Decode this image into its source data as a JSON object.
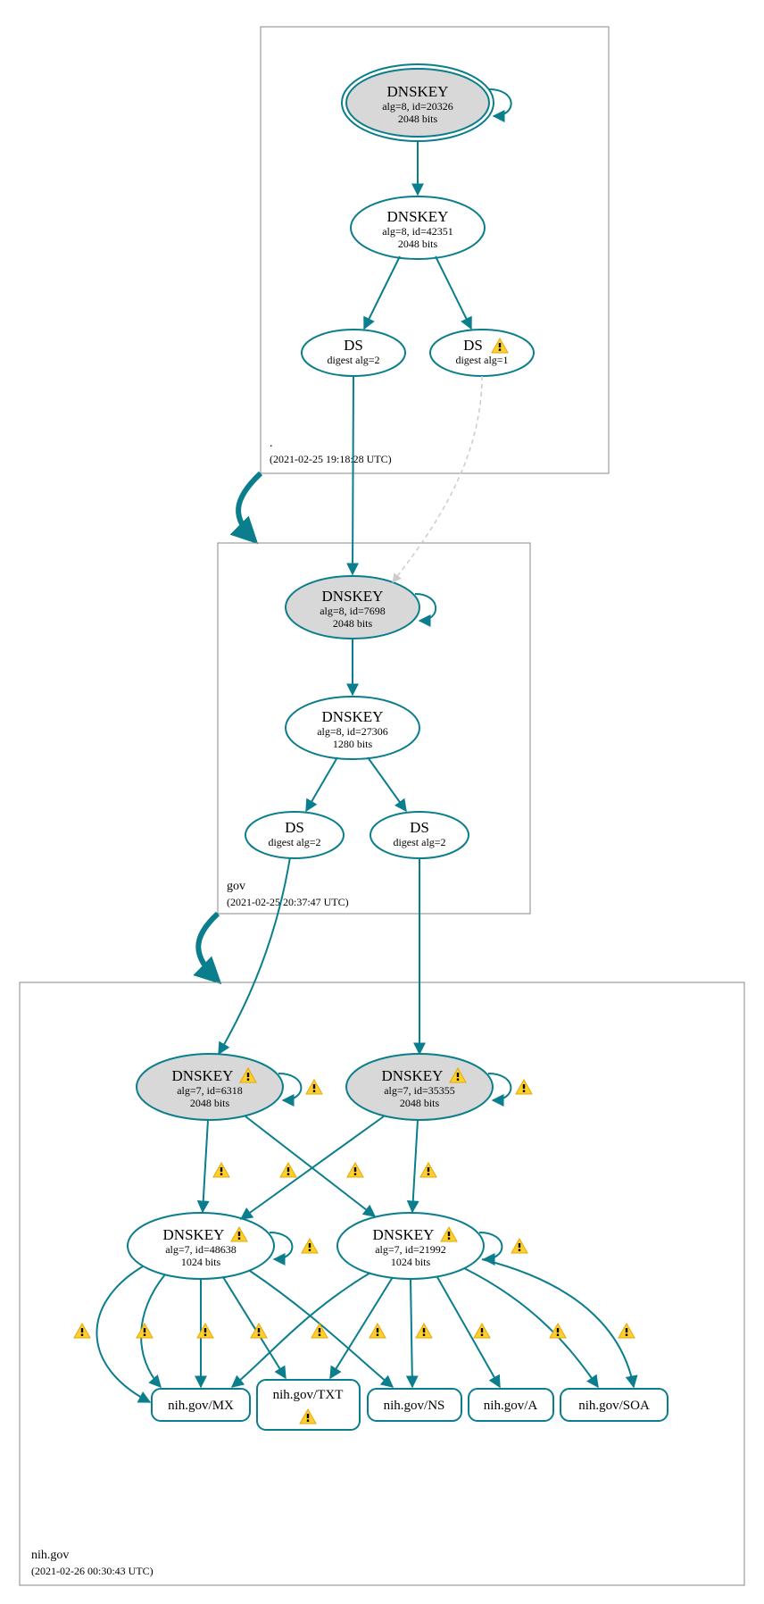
{
  "chart_data": {
    "type": "graph",
    "zones": [
      {
        "name": ".",
        "timestamp": "(2021-02-25 19:18:28 UTC)",
        "nodes": [
          {
            "id": "root_ksk",
            "type": "DNSKEY",
            "title": "DNSKEY",
            "line1": "alg=8, id=20326",
            "line2": "2048 bits",
            "fill": "gray",
            "double_border": true,
            "warn": false
          },
          {
            "id": "root_zsk",
            "type": "DNSKEY",
            "title": "DNSKEY",
            "line1": "alg=8, id=42351",
            "line2": "2048 bits",
            "fill": "white",
            "double_border": false,
            "warn": false
          },
          {
            "id": "root_ds1",
            "type": "DS",
            "title": "DS",
            "line1": "digest alg=2",
            "line2": "",
            "fill": "white",
            "double_border": false,
            "warn": false
          },
          {
            "id": "root_ds2",
            "type": "DS",
            "title": "DS",
            "line1": "digest alg=1",
            "line2": "",
            "fill": "white",
            "double_border": false,
            "warn": true
          }
        ]
      },
      {
        "name": "gov",
        "timestamp": "(2021-02-25 20:37:47 UTC)",
        "nodes": [
          {
            "id": "gov_ksk",
            "type": "DNSKEY",
            "title": "DNSKEY",
            "line1": "alg=8, id=7698",
            "line2": "2048 bits",
            "fill": "gray",
            "double_border": false,
            "warn": false
          },
          {
            "id": "gov_zsk",
            "type": "DNSKEY",
            "title": "DNSKEY",
            "line1": "alg=8, id=27306",
            "line2": "1280 bits",
            "fill": "white",
            "double_border": false,
            "warn": false
          },
          {
            "id": "gov_ds1",
            "type": "DS",
            "title": "DS",
            "line1": "digest alg=2",
            "line2": "",
            "fill": "white",
            "double_border": false,
            "warn": false
          },
          {
            "id": "gov_ds2",
            "type": "DS",
            "title": "DS",
            "line1": "digest alg=2",
            "line2": "",
            "fill": "white",
            "double_border": false,
            "warn": false
          }
        ]
      },
      {
        "name": "nih.gov",
        "timestamp": "(2021-02-26 00:30:43 UTC)",
        "nodes": [
          {
            "id": "nih_ksk1",
            "type": "DNSKEY",
            "title": "DNSKEY",
            "line1": "alg=7, id=6318",
            "line2": "2048 bits",
            "fill": "gray",
            "double_border": false,
            "warn": true
          },
          {
            "id": "nih_ksk2",
            "type": "DNSKEY",
            "title": "DNSKEY",
            "line1": "alg=7, id=35355",
            "line2": "2048 bits",
            "fill": "gray",
            "double_border": false,
            "warn": true
          },
          {
            "id": "nih_zsk1",
            "type": "DNSKEY",
            "title": "DNSKEY",
            "line1": "alg=7, id=48638",
            "line2": "1024 bits",
            "fill": "white",
            "double_border": false,
            "warn": true
          },
          {
            "id": "nih_zsk2",
            "type": "DNSKEY",
            "title": "DNSKEY",
            "line1": "alg=7, id=21992",
            "line2": "1024 bits",
            "fill": "white",
            "double_border": false,
            "warn": true
          }
        ],
        "rrsets": [
          {
            "id": "rr_mx",
            "label": "nih.gov/MX",
            "warn": false
          },
          {
            "id": "rr_txt",
            "label": "nih.gov/TXT",
            "warn": true
          },
          {
            "id": "rr_ns",
            "label": "nih.gov/NS",
            "warn": false
          },
          {
            "id": "rr_a",
            "label": "nih.gov/A",
            "warn": false
          },
          {
            "id": "rr_soa",
            "label": "nih.gov/SOA",
            "warn": false
          }
        ]
      }
    ],
    "edges": [
      {
        "from": "root_ksk",
        "to": "root_ksk",
        "style": "self",
        "warn": false
      },
      {
        "from": "root_ksk",
        "to": "root_zsk",
        "style": "solid",
        "warn": false
      },
      {
        "from": "root_zsk",
        "to": "root_ds1",
        "style": "solid",
        "warn": false
      },
      {
        "from": "root_zsk",
        "to": "root_ds2",
        "style": "solid",
        "warn": false
      },
      {
        "from": "root_ds1",
        "to": "gov_ksk",
        "style": "solid",
        "warn": false
      },
      {
        "from": "root_ds2",
        "to": "gov_ksk",
        "style": "dashed",
        "warn": false
      },
      {
        "from": "gov_ksk",
        "to": "gov_ksk",
        "style": "self",
        "warn": false
      },
      {
        "from": "gov_ksk",
        "to": "gov_zsk",
        "style": "solid",
        "warn": false
      },
      {
        "from": "gov_zsk",
        "to": "gov_ds1",
        "style": "solid",
        "warn": false
      },
      {
        "from": "gov_zsk",
        "to": "gov_ds2",
        "style": "solid",
        "warn": false
      },
      {
        "from": "gov_ds1",
        "to": "nih_ksk1",
        "style": "solid",
        "warn": false
      },
      {
        "from": "gov_ds2",
        "to": "nih_ksk2",
        "style": "solid",
        "warn": false
      },
      {
        "from": "nih_ksk1",
        "to": "nih_ksk1",
        "style": "self",
        "warn": true
      },
      {
        "from": "nih_ksk2",
        "to": "nih_ksk2",
        "style": "self",
        "warn": true
      },
      {
        "from": "nih_ksk1",
        "to": "nih_zsk1",
        "style": "solid",
        "warn": true
      },
      {
        "from": "nih_ksk1",
        "to": "nih_zsk2",
        "style": "solid",
        "warn": true
      },
      {
        "from": "nih_ksk2",
        "to": "nih_zsk1",
        "style": "solid",
        "warn": true
      },
      {
        "from": "nih_ksk2",
        "to": "nih_zsk2",
        "style": "solid",
        "warn": true
      },
      {
        "from": "nih_zsk1",
        "to": "nih_zsk1",
        "style": "self",
        "warn": true
      },
      {
        "from": "nih_zsk2",
        "to": "nih_zsk2",
        "style": "self",
        "warn": true
      },
      {
        "from": "nih_zsk1",
        "to": "rr_mx",
        "style": "solid",
        "warn": true
      },
      {
        "from": "nih_zsk1",
        "to": "rr_txt",
        "style": "solid",
        "warn": true
      },
      {
        "from": "nih_zsk1",
        "to": "rr_ns",
        "style": "solid",
        "warn": true
      },
      {
        "from": "nih_zsk1",
        "to": "rr_a",
        "style": "solid",
        "warn": true
      },
      {
        "from": "nih_zsk1",
        "to": "rr_soa",
        "style": "solid",
        "warn": true
      },
      {
        "from": "nih_zsk2",
        "to": "rr_mx",
        "style": "solid",
        "warn": true
      },
      {
        "from": "nih_zsk2",
        "to": "rr_txt",
        "style": "solid",
        "warn": true
      },
      {
        "from": "nih_zsk2",
        "to": "rr_ns",
        "style": "solid",
        "warn": true
      },
      {
        "from": "nih_zsk2",
        "to": "rr_a",
        "style": "solid",
        "warn": true
      },
      {
        "from": "nih_zsk2",
        "to": "rr_soa",
        "style": "solid",
        "warn": true
      }
    ],
    "zone_arrows": [
      {
        "from_zone": ".",
        "to_zone": "gov"
      },
      {
        "from_zone": "gov",
        "to_zone": "nih.gov"
      }
    ]
  }
}
